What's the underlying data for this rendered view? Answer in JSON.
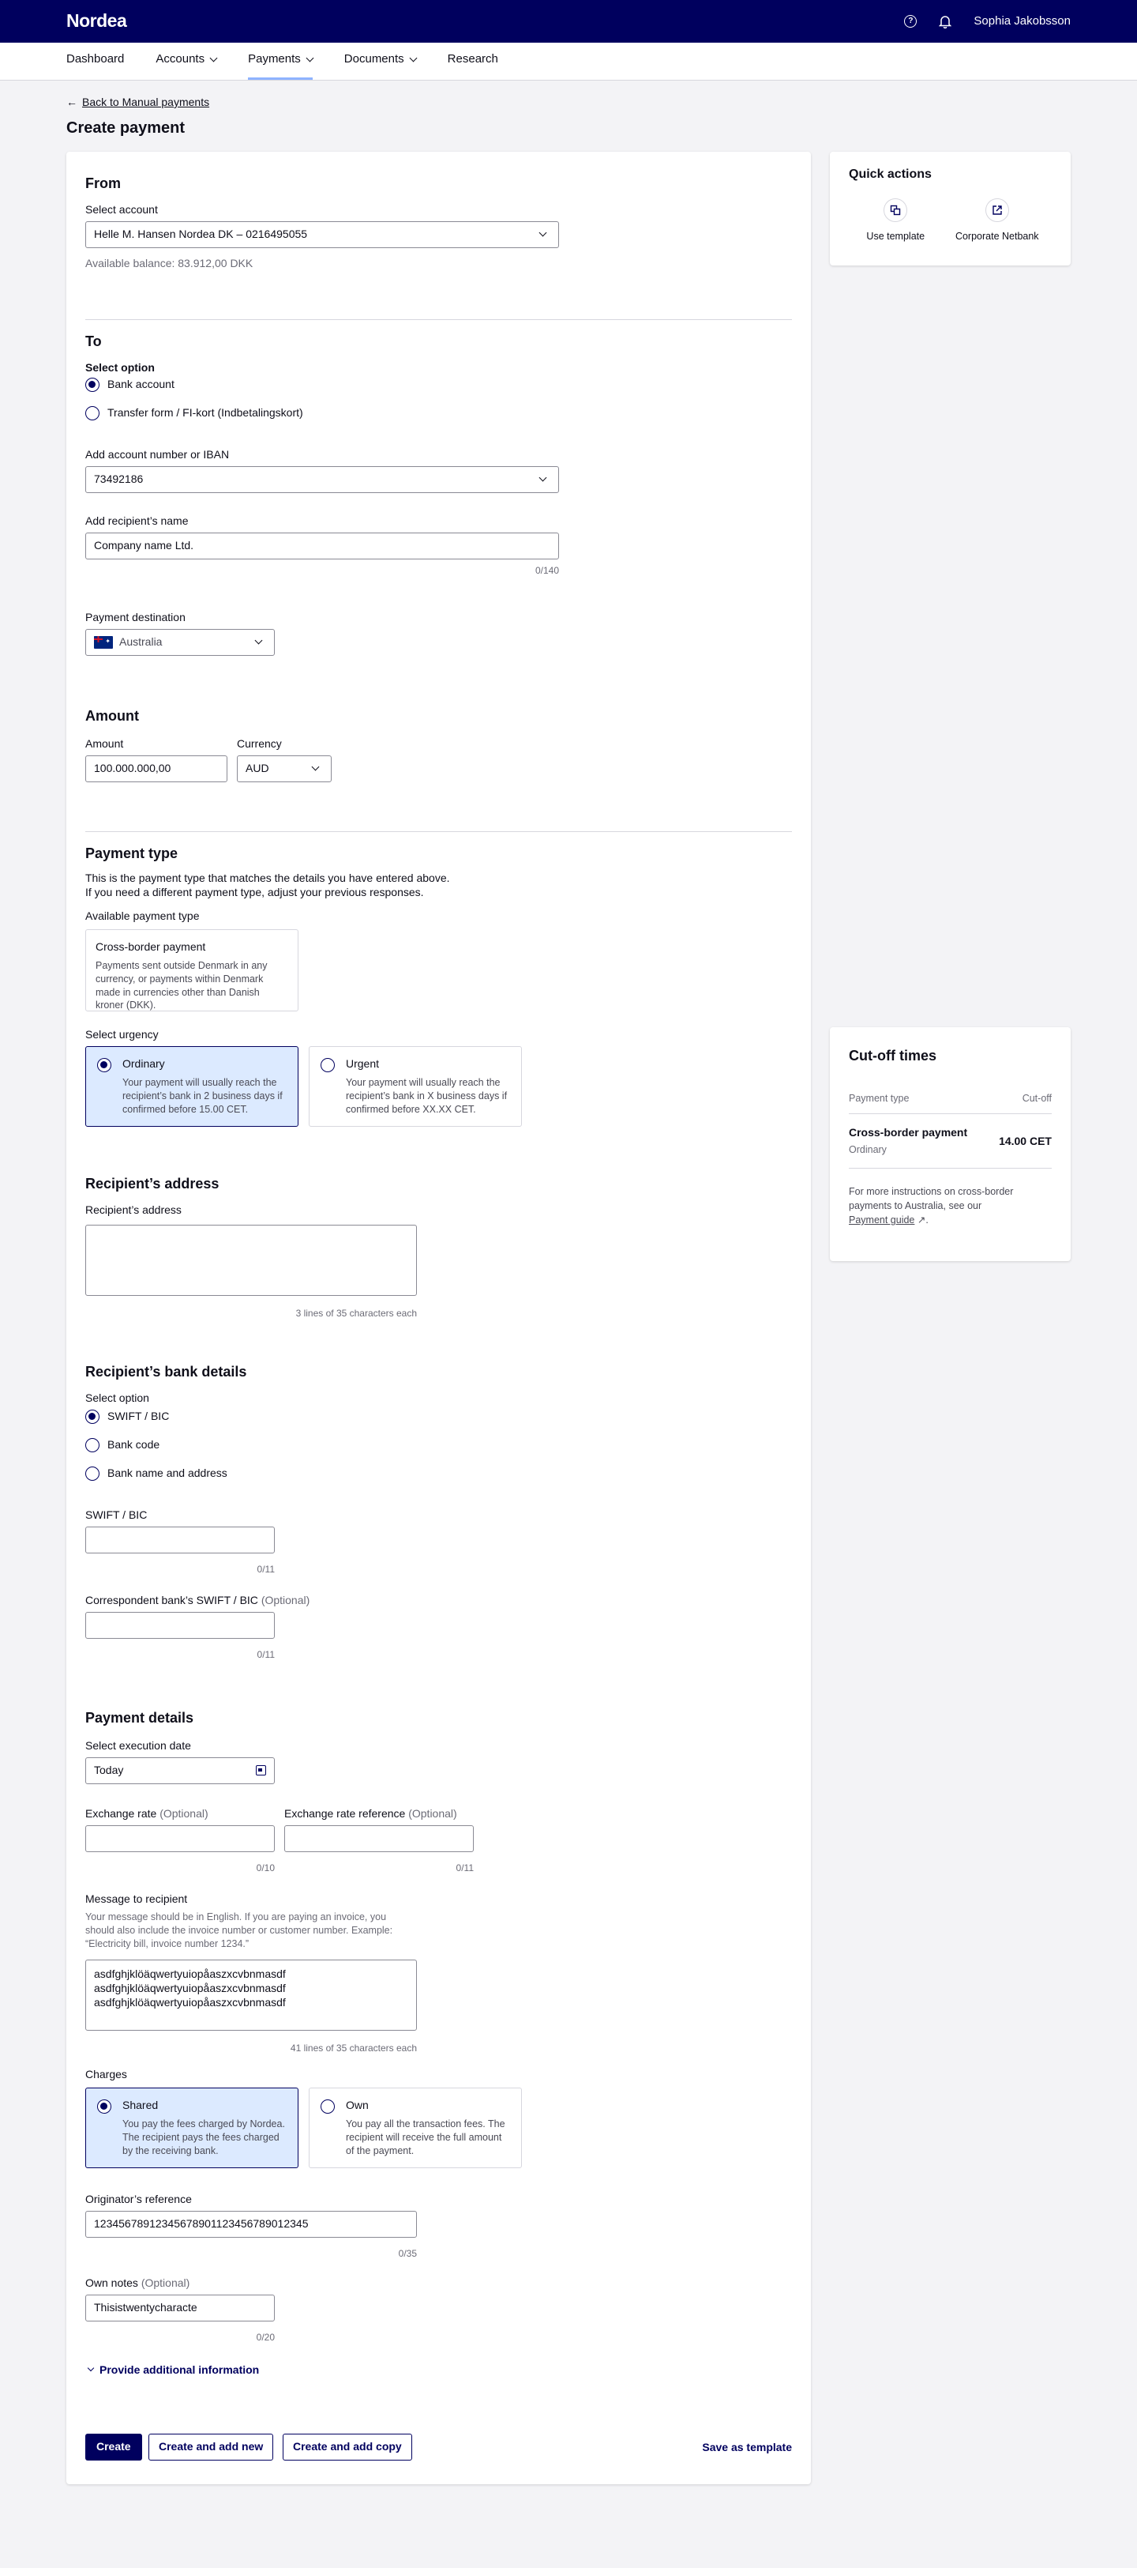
{
  "header": {
    "logo": "Nordea",
    "user_name": "Sophia Jakobsson",
    "help_glyph": "?"
  },
  "nav": [
    {
      "label": "Dashboard"
    },
    {
      "label": "Accounts"
    },
    {
      "label": "Payments"
    },
    {
      "label": "Documents"
    },
    {
      "label": "Research"
    }
  ],
  "back_link": "Back to Manual payments",
  "page_title": "Create payment",
  "from": {
    "title": "From",
    "label": "Select account",
    "value": "Helle M. Hansen Nordea DK – 0216495055",
    "balance": "Available balance: 83.912,00 DKK"
  },
  "to": {
    "title": "To",
    "option_label": "Select option",
    "options": [
      "Bank account",
      "Transfer form / FI-kort (Indbetalingskort)"
    ],
    "account_label": "Add account number or IBAN",
    "account_value": "73492186",
    "name_label": "Add recipient’s name",
    "name_value": "Company name Ltd.",
    "name_counter": "0/140",
    "destination_label": "Payment destination",
    "destination_value": "Australia"
  },
  "amount": {
    "title": "Amount",
    "amount_label": "Amount",
    "amount_value": "100.000.000,00",
    "currency_label": "Currency",
    "currency_value": "AUD"
  },
  "payment_type": {
    "title": "Payment type",
    "desc1": "This is the payment type that matches the details you have entered above.",
    "desc2": "If you need a different payment type, adjust your previous responses.",
    "available_label": "Available payment type",
    "card_title": "Cross-border payment",
    "card_desc": "Payments sent outside Denmark in any currency, or payments within Denmark made in currencies other than Danish kroner (DKK).",
    "urgency_label": "Select urgency",
    "ordinary_title": "Ordinary",
    "ordinary_desc": "Your payment will usually reach the recipient’s bank in 2 business days if confirmed before 15.00 CET.",
    "urgent_title": "Urgent",
    "urgent_desc": "Your payment will usually reach the recipient’s bank in X business days if confirmed before XX.XX CET."
  },
  "recipient_address": {
    "title": "Recipient’s address",
    "label": "Recipient’s address",
    "hint": "3 lines of 35 characters each"
  },
  "bank_details": {
    "title": "Recipient’s bank details",
    "option_label": "Select option",
    "options": [
      "SWIFT / BIC",
      "Bank code",
      "Bank name and address"
    ],
    "swift_label": "SWIFT / BIC",
    "swift_counter": "0/11",
    "corr_label": "Correspondent bank’s SWIFT / BIC",
    "corr_optional": "(Optional)",
    "corr_counter": "0/11"
  },
  "payment_details": {
    "title": "Payment details",
    "date_label": "Select execution date",
    "date_value": "Today",
    "rate_label": "Exchange rate",
    "rate_optional": "(Optional)",
    "rate_counter": "0/10",
    "rate_ref_label": "Exchange rate reference",
    "rate_ref_optional": "(Optional)",
    "rate_ref_counter": "0/11",
    "message_label": "Message to recipient",
    "message_help": "Your message should be in English. If you are paying an invoice, you should also include the invoice number or customer number. Example: “Electricity bill, invoice number 1234.”",
    "message_lines": [
      "asdfghjklöäqwertyuiopåaszxcvbnmasdf",
      "asdfghjklöäqwertyuiopåaszxcvbnmasdf",
      "asdfghjklöäqwertyuiopåaszxcvbnmasdf"
    ],
    "message_hint": "41 lines of 35 characters each",
    "charges_label": "Charges",
    "shared_title": "Shared",
    "shared_desc": "You pay the fees charged by Nordea. The recipient pays the fees charged by the receiving bank.",
    "own_title": "Own",
    "own_desc": "You pay all the transaction fees. The recipient will receive the full amount of the payment.",
    "originator_label": "Originator’s reference",
    "originator_value": "12345678912345678901123456789012345",
    "originator_counter": "0/35",
    "notes_label": "Own notes",
    "notes_optional": "(Optional)",
    "notes_value": "Thisistwentycharacte",
    "notes_counter": "0/20",
    "additional_info": "Provide additional information"
  },
  "actions": {
    "create": "Create",
    "create_new": "Create and add new",
    "create_copy": "Create and add copy",
    "save_template": "Save as template"
  },
  "quick_actions": {
    "title": "Quick actions",
    "items": [
      {
        "label": "Use template",
        "icon": "template-icon"
      },
      {
        "label": "Corporate Netbank",
        "icon": "external-link-icon"
      }
    ]
  },
  "cutoff": {
    "title": "Cut-off times",
    "col_type": "Payment type",
    "col_cutoff": "Cut-off",
    "row_type": "Cross-border payment",
    "row_sub": "Ordinary",
    "row_time": "14.00 CET",
    "note": "For more instructions on cross-border payments to Australia, see our",
    "guide_link": "Payment guide"
  },
  "colors": {
    "brand": "#00005e",
    "selected_bg": "#dceaff",
    "page_bg": "#f3f3f6"
  }
}
